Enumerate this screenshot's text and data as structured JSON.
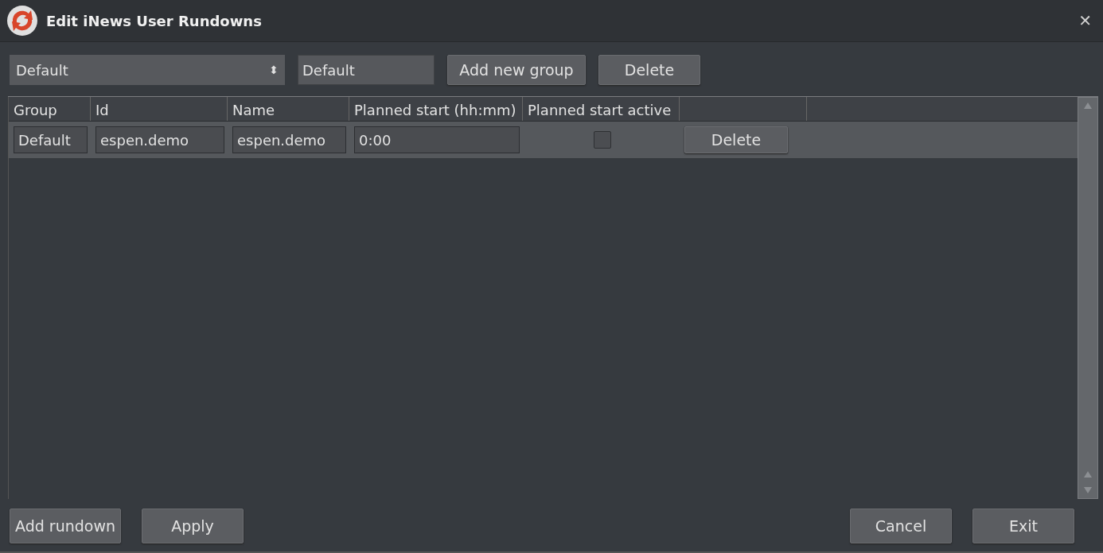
{
  "window": {
    "title": "Edit iNews User Rundowns",
    "close": "✕"
  },
  "toolbar": {
    "group_select": {
      "value": "Default",
      "arrow": "⬍"
    },
    "group_name": {
      "value": "Default"
    },
    "buttons": [
      "Add new group",
      "Delete"
    ]
  },
  "table": {
    "columns": [
      "Group",
      "Id",
      "Name",
      "Planned start (hh:mm)",
      "Planned start active"
    ],
    "rows": [
      {
        "group": "Default",
        "id": "espen.demo",
        "name": "espen.demo",
        "planned_start": "0:00",
        "planned_start_active": false,
        "button": "Delete",
        "selected": true
      }
    ]
  },
  "footer": {
    "left_buttons": [
      "Add rundown",
      "Apply"
    ],
    "right_buttons": [
      "Cancel",
      "Exit"
    ]
  }
}
